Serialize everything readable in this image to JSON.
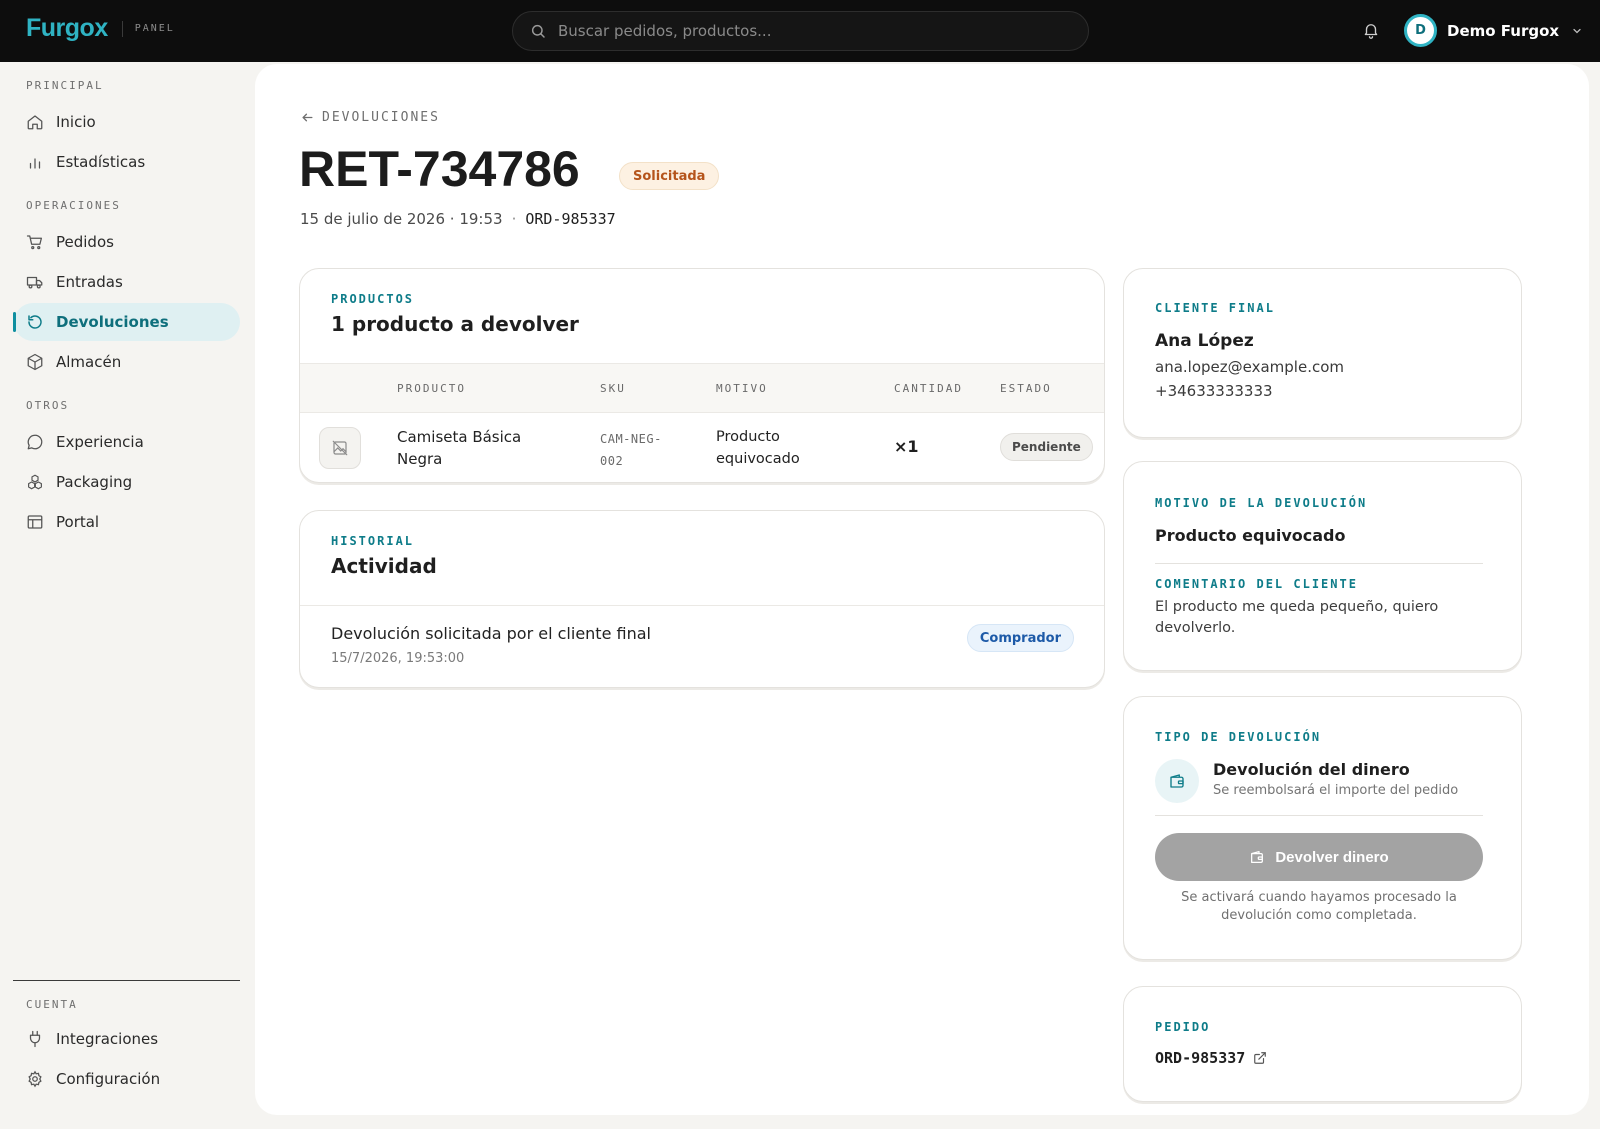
{
  "brand": {
    "name": "Furgox",
    "sub": "PANEL"
  },
  "search": {
    "placeholder": "Buscar pedidos, productos..."
  },
  "user": {
    "initial": "D",
    "name": "Demo Furgox"
  },
  "sidebar": {
    "sections": {
      "principal": "PRINCIPAL",
      "operaciones": "OPERACIONES",
      "otros": "OTROS",
      "cuenta": "CUENTA"
    },
    "items": {
      "inicio": "Inicio",
      "estadisticas": "Estadísticas",
      "pedidos": "Pedidos",
      "entradas": "Entradas",
      "devoluciones": "Devoluciones",
      "almacen": "Almacén",
      "experiencia": "Experiencia",
      "packaging": "Packaging",
      "portal": "Portal",
      "integraciones": "Integraciones",
      "configuracion": "Configuración"
    },
    "active_item": "devoluciones"
  },
  "header": {
    "back_label": "DEVOLUCIONES",
    "title": "RET-734786",
    "status": "Solicitada",
    "date": "15 de julio de 2026 · 19:53",
    "separator": "·",
    "order_ref": "ORD-985337"
  },
  "products": {
    "kicker": "PRODUCTOS",
    "heading": "1 producto a devolver",
    "columns": {
      "product": "PRODUCTO",
      "sku": "SKU",
      "reason": "MOTIVO",
      "quantity": "CANTIDAD",
      "status": "ESTADO"
    },
    "rows": [
      {
        "name_l1": "Camiseta Básica",
        "name_l2": "Negra",
        "sku_l1": "CAM-NEG-",
        "sku_l2": "002",
        "reason_l1": "Producto",
        "reason_l2": "equivocado",
        "quantity": "×1",
        "status": "Pendiente"
      }
    ]
  },
  "history": {
    "kicker": "HISTORIAL",
    "heading": "Actividad",
    "events": [
      {
        "title": "Devolución solicitada por el cliente final",
        "timestamp": "15/7/2026, 19:53:00",
        "actor": "Comprador"
      }
    ]
  },
  "customer": {
    "kicker": "CLIENTE FINAL",
    "name": "Ana López",
    "email": "ana.lopez@example.com",
    "phone": "+34633333333"
  },
  "reason": {
    "kicker": "MOTIVO DE LA DEVOLUCIÓN",
    "value": "Producto equivocado",
    "comment_kicker": "COMENTARIO DEL CLIENTE",
    "comment": "El producto me queda pequeño, quiero devolverlo."
  },
  "refund_type": {
    "kicker": "TIPO DE DEVOLUCIÓN",
    "title": "Devolución del dinero",
    "subtitle": "Se reembolsará el importe del pedido",
    "button": "Devolver dinero",
    "note": "Se activará cuando hayamos procesado la devolución como completada."
  },
  "order": {
    "kicker": "PEDIDO",
    "ref": "ORD-985337"
  },
  "colors": {
    "accent": "#0e7c89",
    "brand": "#2fb3c3",
    "status_requested": "#b5541b",
    "actor_badge": "#1d5aa8",
    "disabled_button": "#a3a3a3"
  }
}
